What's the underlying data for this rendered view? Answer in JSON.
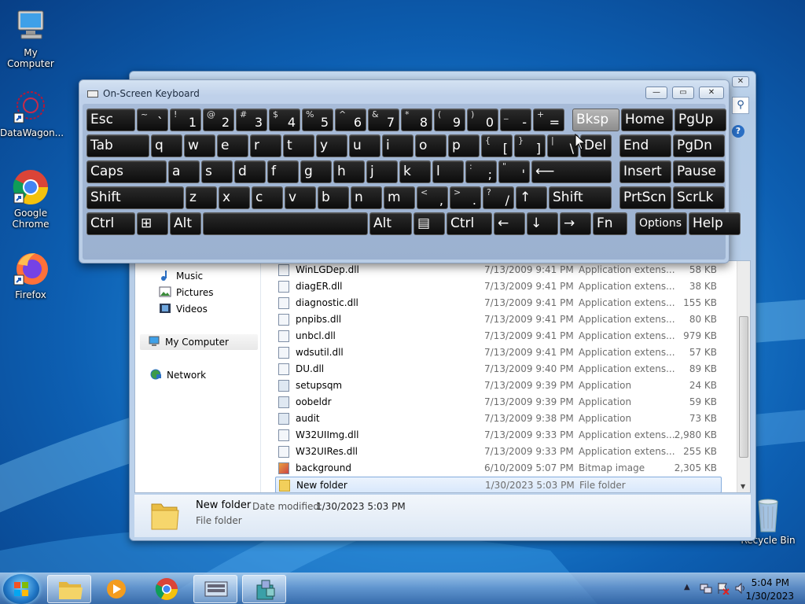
{
  "desktop": {
    "icons": [
      {
        "label": "My Computer"
      },
      {
        "label": "DataWagon..."
      },
      {
        "label": "Google Chrome"
      },
      {
        "label": "Firefox"
      },
      {
        "label": "Recycle Bin"
      }
    ]
  },
  "explorer": {
    "close_label": "✕",
    "search_icon": "search-icon",
    "help_label": "?",
    "nav": [
      {
        "label": "Music",
        "icon": "music-icon"
      },
      {
        "label": "Pictures",
        "icon": "pictures-icon"
      },
      {
        "label": "Videos",
        "icon": "videos-icon"
      },
      {
        "label": "My Computer",
        "icon": "computer-icon"
      },
      {
        "label": "Network",
        "icon": "network-icon"
      }
    ],
    "files": [
      {
        "name": "WinLGDep.dll",
        "date": "7/13/2009 9:41 PM",
        "type": "Application extens...",
        "size": "58 KB"
      },
      {
        "name": "diagER.dll",
        "date": "7/13/2009 9:41 PM",
        "type": "Application extens...",
        "size": "38 KB"
      },
      {
        "name": "diagnostic.dll",
        "date": "7/13/2009 9:41 PM",
        "type": "Application extens...",
        "size": "155 KB"
      },
      {
        "name": "pnpibs.dll",
        "date": "7/13/2009 9:41 PM",
        "type": "Application extens...",
        "size": "80 KB"
      },
      {
        "name": "unbcl.dll",
        "date": "7/13/2009 9:41 PM",
        "type": "Application extens...",
        "size": "979 KB"
      },
      {
        "name": "wdsutil.dll",
        "date": "7/13/2009 9:41 PM",
        "type": "Application extens...",
        "size": "57 KB"
      },
      {
        "name": "DU.dll",
        "date": "7/13/2009 9:40 PM",
        "type": "Application extens...",
        "size": "89 KB"
      },
      {
        "name": "setupsqm",
        "date": "7/13/2009 9:39 PM",
        "type": "Application",
        "size": "24 KB"
      },
      {
        "name": "oobeldr",
        "date": "7/13/2009 9:39 PM",
        "type": "Application",
        "size": "59 KB"
      },
      {
        "name": "audit",
        "date": "7/13/2009 9:38 PM",
        "type": "Application",
        "size": "73 KB"
      },
      {
        "name": "W32UIImg.dll",
        "date": "7/13/2009 9:33 PM",
        "type": "Application extens...",
        "size": "2,980 KB"
      },
      {
        "name": "W32UIRes.dll",
        "date": "7/13/2009 9:33 PM",
        "type": "Application extens...",
        "size": "255 KB"
      },
      {
        "name": "background",
        "date": "6/10/2009 5:07 PM",
        "type": "Bitmap image",
        "size": "2,305 KB"
      },
      {
        "name": "New folder",
        "date": "1/30/2023 5:03 PM",
        "type": "File folder",
        "size": ""
      }
    ],
    "details": {
      "name": "New folder",
      "modified_label": "Date modified:",
      "modified_value": "1/30/2023 5:03 PM",
      "type": "File folder"
    }
  },
  "osk": {
    "title": "On-Screen Keyboard",
    "minimize_label": "—",
    "maximize_label": "▭",
    "close_label": "✕",
    "rows": [
      [
        {
          "label": "Esc"
        },
        {
          "small": "~",
          "big": "`"
        },
        {
          "small": "!",
          "big": "1"
        },
        {
          "small": "@",
          "big": "2"
        },
        {
          "small": "#",
          "big": "3"
        },
        {
          "small": "$",
          "big": "4"
        },
        {
          "small": "%",
          "big": "5"
        },
        {
          "small": "^",
          "big": "6"
        },
        {
          "small": "&",
          "big": "7"
        },
        {
          "small": "*",
          "big": "8"
        },
        {
          "small": "(",
          "big": "9"
        },
        {
          "small": ")",
          "big": "0"
        },
        {
          "small": "_",
          "big": "-"
        },
        {
          "small": "+",
          "big": "="
        },
        {
          "label": "Bksp"
        },
        {
          "label": "Home"
        },
        {
          "label": "PgUp"
        }
      ],
      [
        {
          "label": "Tab"
        },
        {
          "label": "q"
        },
        {
          "label": "w"
        },
        {
          "label": "e"
        },
        {
          "label": "r"
        },
        {
          "label": "t"
        },
        {
          "label": "y"
        },
        {
          "label": "u"
        },
        {
          "label": "i"
        },
        {
          "label": "o"
        },
        {
          "label": "p"
        },
        {
          "small": "{",
          "big": "["
        },
        {
          "small": "}",
          "big": "]"
        },
        {
          "small": "|",
          "big": "\\"
        },
        {
          "label": "Del"
        },
        {
          "label": "End"
        },
        {
          "label": "PgDn"
        }
      ],
      [
        {
          "label": "Caps"
        },
        {
          "label": "a"
        },
        {
          "label": "s"
        },
        {
          "label": "d"
        },
        {
          "label": "f"
        },
        {
          "label": "g"
        },
        {
          "label": "h"
        },
        {
          "label": "j"
        },
        {
          "label": "k"
        },
        {
          "label": "l"
        },
        {
          "small": ":",
          "big": ";"
        },
        {
          "small": "\"",
          "big": "'"
        },
        {
          "label": "⟵"
        },
        {
          "label": "Insert"
        },
        {
          "label": "Pause"
        }
      ],
      [
        {
          "label": "Shift"
        },
        {
          "label": "z"
        },
        {
          "label": "x"
        },
        {
          "label": "c"
        },
        {
          "label": "v"
        },
        {
          "label": "b"
        },
        {
          "label": "n"
        },
        {
          "label": "m"
        },
        {
          "small": "<",
          "big": ","
        },
        {
          "small": ">",
          "big": "."
        },
        {
          "small": "?",
          "big": "/"
        },
        {
          "label": "↑"
        },
        {
          "label": "Shift"
        },
        {
          "label": "PrtScn"
        },
        {
          "label": "ScrLk"
        }
      ],
      [
        {
          "label": "Ctrl"
        },
        {
          "label": "⊞"
        },
        {
          "label": "Alt"
        },
        {
          "label": ""
        },
        {
          "label": "Alt"
        },
        {
          "label": "▤"
        },
        {
          "label": "Ctrl"
        },
        {
          "label": "←"
        },
        {
          "label": "↓"
        },
        {
          "label": "→"
        },
        {
          "label": "Fn"
        },
        {
          "label": "Options"
        },
        {
          "label": "Help"
        }
      ]
    ]
  },
  "taskbar": {
    "apps": [
      "Windows Explorer",
      "Windows Media Player",
      "Google Chrome",
      "On-Screen Keyboard",
      "Setup"
    ],
    "clock_time": "5:04 PM",
    "clock_date": "1/30/2023"
  }
}
